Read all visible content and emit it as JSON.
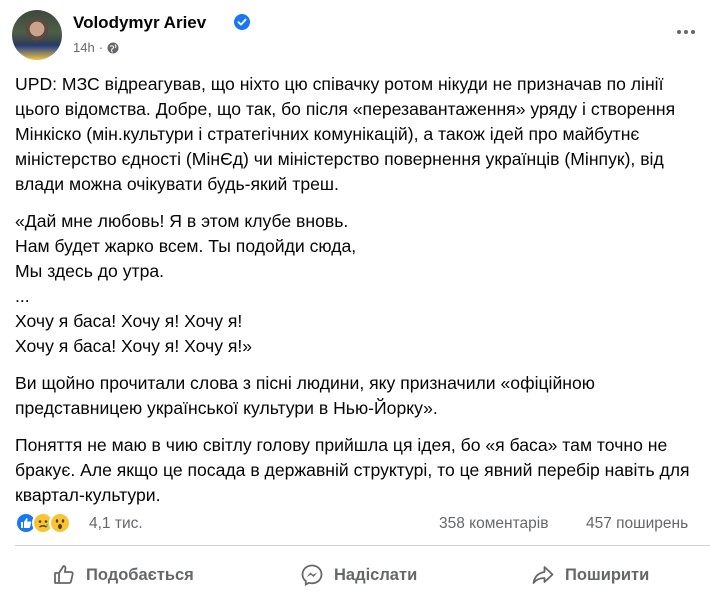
{
  "post": {
    "author": "Volodymyr Ariev",
    "time": "14h",
    "paragraphs": [
      "UPD: МЗС відреагував, що ніхто цю співачку ротом нікуди не призначав по лінії цього відомства. Добре, що так, бо після «перезавантаження» уряду і створення Мінкіско (мін.культури і стратегічних комунікацій), а також ідей про майбутнє міністерство єдності (МінЄд) чи міністерство повернення українців (Мінпук), від влади можна очікувати будь-який треш.",
      "«Дай мне любовь! Я в этом клубе вновь.\nНам будет жарко всем. Ты подойди сюда,\nМы здесь до утра.\n...\nХочу я баса! Хочу я! Хочу я!\nХочу я баса! Хочу я! Хочу я!»",
      "Ви щойно прочитали слова з пісні людини, яку призначили «офіційною представницею української культури в Нью-Йорку».",
      "Поняття не маю в чию світлу голову прийшла ця ідея, бо «я баса» там точно не бракує. Але якщо це посада в державній структурі, то це явний перебір навіть для квартал-культури."
    ]
  },
  "stats": {
    "reactions_count": "4,1 тис.",
    "comments": "358 коментарів",
    "shares": "457 поширень"
  },
  "actions": {
    "like": "Подобається",
    "send": "Надіслати",
    "share": "Поширити"
  },
  "colors": {
    "accent": "#1877f2",
    "secondary_text": "#65676b",
    "reaction_yellow": "#f7c433"
  }
}
